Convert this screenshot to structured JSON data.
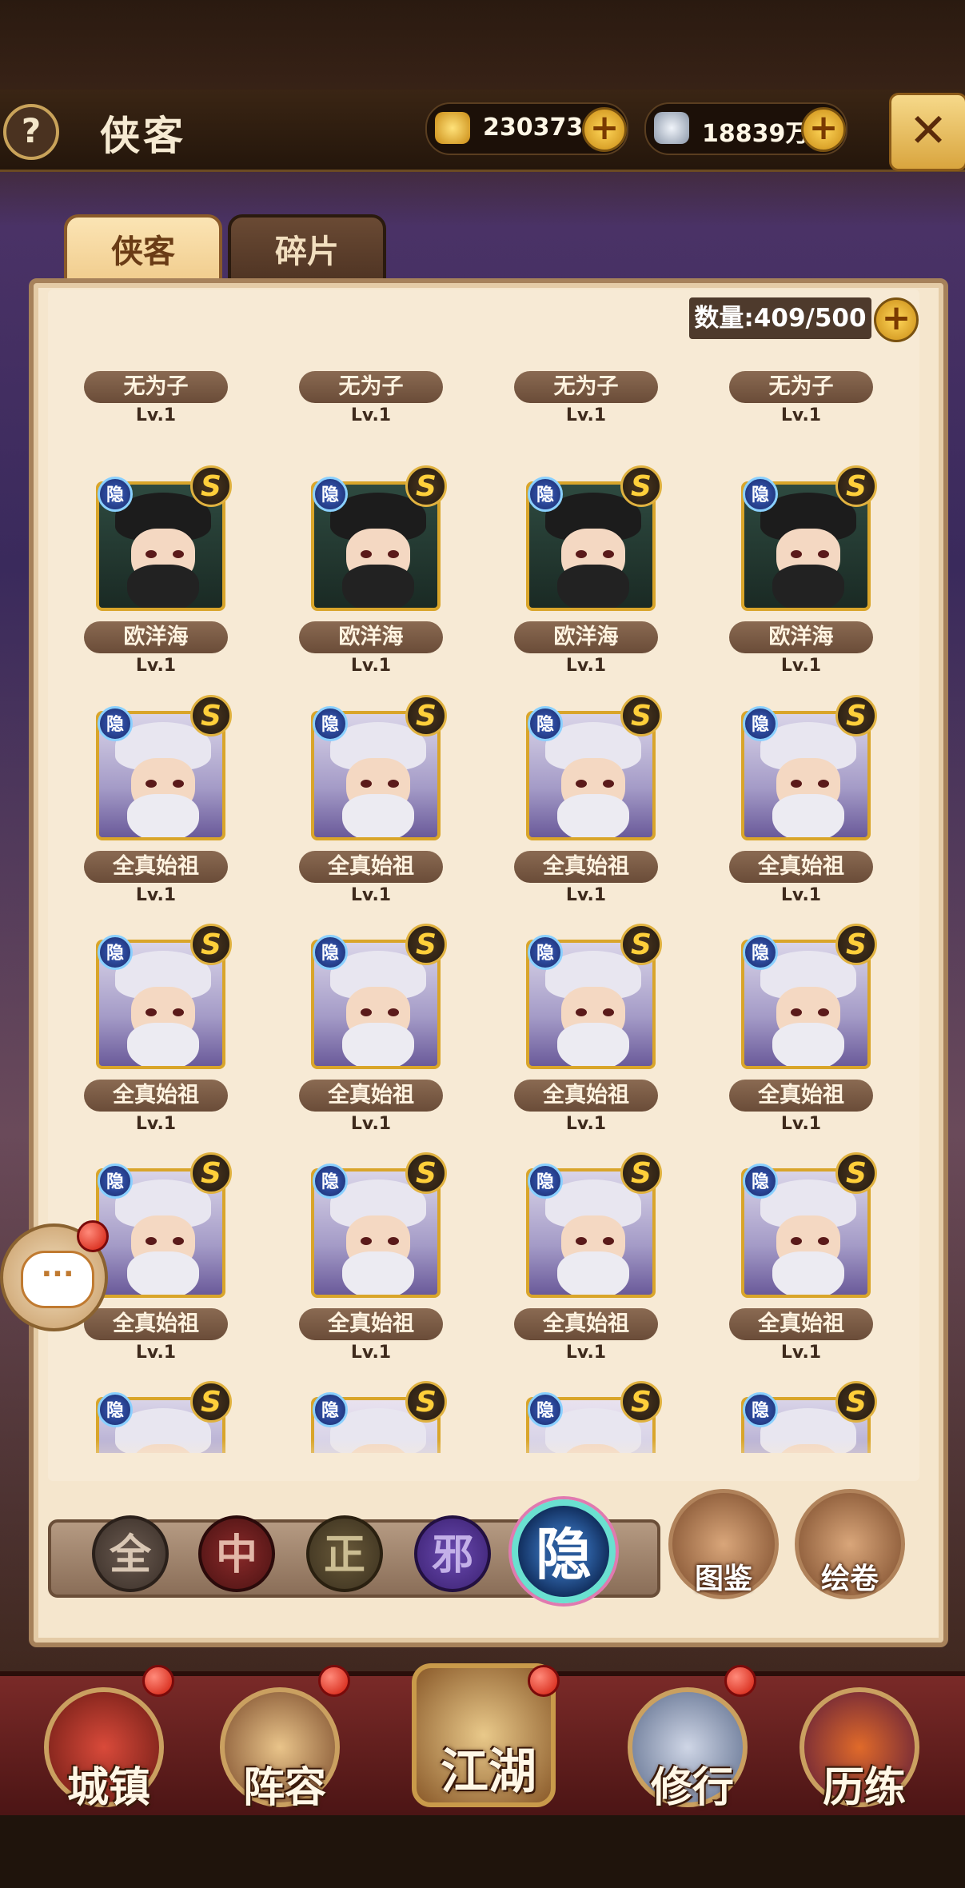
{
  "header": {
    "title": "侠客",
    "help_label": "?",
    "gold_value": "230373",
    "silver_value": "18839万",
    "plus_label": "+",
    "close_label": "✕"
  },
  "tabs": [
    {
      "label": "侠客",
      "active": true
    },
    {
      "label": "碎片",
      "active": false
    }
  ],
  "roster": {
    "count_label": "数量:409/500",
    "badge_hidden": "隐",
    "rank": "S",
    "rows": [
      {
        "name": "无为子",
        "level": "Lv.1"
      },
      {
        "name": "欧洋海",
        "level": "Lv.1"
      },
      {
        "name": "全真始祖",
        "level": "Lv.1"
      },
      {
        "name": "全真始祖",
        "level": "Lv.1"
      },
      {
        "name": "全真始祖",
        "level": "Lv.1"
      }
    ]
  },
  "filters": [
    {
      "label": "全"
    },
    {
      "label": "中"
    },
    {
      "label": "正"
    },
    {
      "label": "邪"
    },
    {
      "label": "隐",
      "selected": true
    }
  ],
  "side_buttons": {
    "codex": "图鉴",
    "scroll": "绘卷"
  },
  "chat": {
    "icon": "chat-bubble-icon",
    "label": "···"
  },
  "nav": [
    {
      "label": "城镇",
      "badge": true
    },
    {
      "label": "阵容",
      "badge": true
    },
    {
      "label": "江湖",
      "badge": true
    },
    {
      "label": "修行",
      "badge": true
    },
    {
      "label": "历练",
      "badge": false
    }
  ],
  "colors": {
    "accent_gold": "#d9a52a",
    "panel_bg": "#f7ead5",
    "name_pill": "#7a5a44",
    "nav_bg": "#6a2222"
  }
}
